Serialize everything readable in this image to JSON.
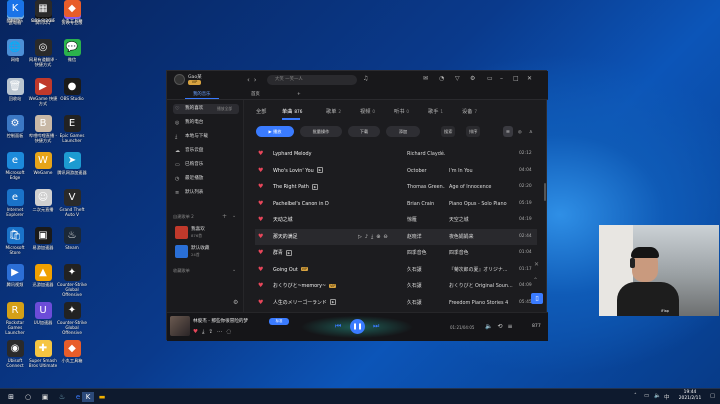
{
  "desktop_icons": [
    {
      "label": "此电脑",
      "color": "#7fb3e6",
      "glyph": "🖥"
    },
    {
      "label": "腾讯QQ",
      "color": "#111111",
      "glyph": "🐧"
    },
    {
      "label": "剪映专业版",
      "color": "#8a5cf6",
      "glyph": "✂"
    },
    {
      "label": "网络",
      "color": "#4c8fd6",
      "glyph": "🌐"
    },
    {
      "label": "网易有道翻译 - 快捷方式",
      "color": "#2a2a2a",
      "glyph": "◎"
    },
    {
      "label": "微信",
      "color": "#2bb24c",
      "glyph": "💬"
    },
    {
      "label": "回收站",
      "color": "#b9c4cf",
      "glyph": "🗑"
    },
    {
      "label": "WeGame 快捷方式",
      "color": "#c0392b",
      "glyph": "▶"
    },
    {
      "label": "OBS Studio",
      "color": "#1a1a1a",
      "glyph": "●"
    },
    {
      "label": "控制面板",
      "color": "#3b78c4",
      "glyph": "⚙"
    },
    {
      "label": "哔哩哔哩直播 - 快捷方式",
      "color": "#c8b8a6",
      "glyph": "B"
    },
    {
      "label": "Epic Games Launcher",
      "color": "#222222",
      "glyph": "E"
    },
    {
      "label": "Microsoft Edge",
      "color": "#1c8adb",
      "glyph": "e"
    },
    {
      "label": "WeGame",
      "color": "#e6a419",
      "glyph": "W"
    },
    {
      "label": "腾讯网游加速器",
      "color": "#1d9bd1",
      "glyph": "➤"
    },
    {
      "label": "Internet Explorer",
      "color": "#1a73c9",
      "glyph": "e"
    },
    {
      "label": "二次元直播",
      "color": "#d0d0d0",
      "glyph": "☺"
    },
    {
      "label": "Grand Theft Auto V",
      "color": "#2a2a2a",
      "glyph": "V"
    },
    {
      "label": "Microsoft Store",
      "color": "#1a73c9",
      "glyph": "🛍"
    },
    {
      "label": "易游加速器",
      "color": "#1a1a1a",
      "glyph": "▣"
    },
    {
      "label": "Steam",
      "color": "#1b2838",
      "glyph": "♨"
    },
    {
      "label": "腾讯视频",
      "color": "#2c6fd6",
      "glyph": "▶"
    },
    {
      "label": "迅游加速器",
      "color": "#f0a000",
      "glyph": "▲"
    },
    {
      "label": "Counter-Strike Global Offensive",
      "color": "#222222",
      "glyph": "✦"
    },
    {
      "label": "Rockstar Games Launcher",
      "color": "#d4a017",
      "glyph": "R"
    },
    {
      "label": "UU加速器",
      "color": "#6c4cd8",
      "glyph": "U"
    },
    {
      "label": "Counter-Strike Global Offensive",
      "color": "#222222",
      "glyph": "✦"
    },
    {
      "label": "Ubisoft Connect",
      "color": "#2a2a2a",
      "glyph": "◉"
    },
    {
      "label": "Super Smash Bros Ultimate",
      "color": "#f5c542",
      "glyph": "✚"
    },
    {
      "label": "小丸工具箱",
      "color": "#e85d2a",
      "glyph": "◆"
    },
    {
      "label": "爱奇艺",
      "color": "#00c26f",
      "glyph": "Q"
    },
    {
      "label": "OBS Studio",
      "color": "#1a1a1a",
      "glyph": "●"
    },
    {
      "label": "小丸工具箱",
      "color": "#e85d2a",
      "glyph": "◆"
    },
    {
      "label": "酷狗音乐",
      "color": "#1a73e8",
      "glyph": "K"
    },
    {
      "label": "Screen2GIF",
      "color": "#2a2a2a",
      "glyph": "▦"
    }
  ],
  "app": {
    "user": {
      "name": "Gao某",
      "vip": "VIP"
    },
    "search_placeholder": "大笑 一笑一人",
    "top_tabs": [
      {
        "label": "我的音乐",
        "active": true
      },
      {
        "label": "首页",
        "active": false
      }
    ],
    "sidebar": {
      "items": [
        {
          "label": "我的喜欢",
          "badge": "播放全部",
          "icon": "heart-icon",
          "glyph": "♡",
          "active": true
        },
        {
          "label": "我的电台",
          "icon": "radio-icon",
          "glyph": "◎",
          "active": false
        },
        {
          "label": "本地与下载",
          "icon": "download-icon",
          "glyph": "⤓",
          "active": false
        },
        {
          "label": "音乐云盘",
          "icon": "cloud-icon",
          "glyph": "☁",
          "active": false
        },
        {
          "label": "已购音乐",
          "icon": "bag-icon",
          "glyph": "▭",
          "active": false
        },
        {
          "label": "最近播放",
          "icon": "clock-icon",
          "glyph": "◷",
          "active": false
        },
        {
          "label": "默认列表",
          "icon": "list-icon",
          "glyph": "≡",
          "active": false
        }
      ],
      "created_header": "自建歌单",
      "created_count": "2",
      "playlists": [
        {
          "name": "我喜欢",
          "count": "876首",
          "color": "#c0392b"
        },
        {
          "name": "默认收藏",
          "count": "24首",
          "color": "#2a6fd6"
        }
      ],
      "collected_header": "收藏歌单"
    },
    "content_tabs": [
      {
        "label": "全部",
        "count": "",
        "active": false
      },
      {
        "label": "单曲",
        "count": "876",
        "active": true
      },
      {
        "label": "歌单",
        "count": "2",
        "active": false
      },
      {
        "label": "视频",
        "count": "0",
        "active": false
      },
      {
        "label": "听书",
        "count": "0",
        "active": false
      },
      {
        "label": "歌手",
        "count": "1",
        "active": false
      },
      {
        "label": "设备",
        "count": "7",
        "active": false
      }
    ],
    "actions": {
      "play": "▶ 播放",
      "batch": "批量操作",
      "download": "下载",
      "add": "添加",
      "search": "搜索",
      "sort": "排序"
    },
    "songs": [
      {
        "title": "Lyphard Melody",
        "tag": "",
        "artist": "Richard Claydé...",
        "album": "",
        "duration": "02:12"
      },
      {
        "title": "Who's Lovin' You",
        "tag": "MV",
        "artist": "October",
        "album": "I'm In You",
        "duration": "04:04"
      },
      {
        "title": "The Right Path",
        "tag": "MV",
        "artist": "Thomas Green...",
        "album": "Age of Innocence",
        "duration": "02:20"
      },
      {
        "title": "Pachelbel's Canon in D",
        "tag": "",
        "artist": "Brian Crain",
        "album": "Piano Opus - Solo Piano",
        "duration": "05:19"
      },
      {
        "title": "天动之城",
        "tag": "",
        "artist": "惊雁",
        "album": "天空之城",
        "duration": "04:19"
      },
      {
        "title": "那天的满足",
        "tag": "",
        "artist": "赵晓洋",
        "album": "夜色娟娟来",
        "duration": "02:44"
      },
      {
        "title": "群青",
        "tag": "MV",
        "artist": "四季音色",
        "album": "四季音色",
        "duration": "01:04"
      },
      {
        "title": "Going Out",
        "tag": "VIP",
        "artist": "久石譲",
        "album": "『菊次郎の夏』オリジナ...",
        "duration": "01:17"
      },
      {
        "title": "おくりびと~memory~",
        "tag": "VIP",
        "artist": "久石譲",
        "album": "おくりびと Original Soun...",
        "duration": "04:09"
      },
      {
        "title": "人生のメリーゴーランド",
        "tag": "MV",
        "artist": "久石譲",
        "album": "Freedom Piano Stories 4",
        "duration": "05:45"
      }
    ],
    "player": {
      "title": "林俊杰 - 那些你很冒险的梦",
      "quality": "标准",
      "time": "01:21/04:05",
      "count": "877"
    }
  },
  "webcam": {
    "caption": "iFlap"
  },
  "clock": {
    "time": "19:44",
    "date": "2021/2/11"
  }
}
